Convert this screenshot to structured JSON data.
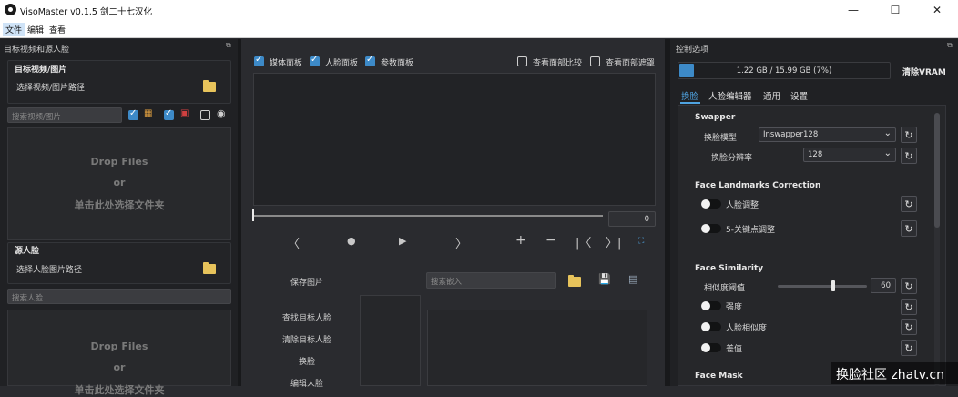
{
  "window": {
    "title": "VisoMaster v0.1.5 剑二十七汉化",
    "minimize": "—",
    "maximize": "☐",
    "close": "✕"
  },
  "menubar": [
    "文件",
    "编辑",
    "查看"
  ],
  "left_dock": {
    "title": "目标视频和源人脸",
    "target_group": {
      "label": "目标视频/图片",
      "path_label": "选择视频/图片路径"
    },
    "search_video": {
      "placeholder": "搜索视频/图片"
    },
    "drop1": {
      "line1": "Drop Files",
      "line2": "or",
      "line3": "单击此处选择文件夹"
    },
    "source_group": {
      "label": "源人脸",
      "path_label": "选择人脸图片路径"
    },
    "search_face": {
      "placeholder": "搜索人脸"
    },
    "drop2": {
      "line1": "Drop Files",
      "line2": "or",
      "line3": "单击此处选择文件夹"
    }
  },
  "center": {
    "checks": [
      {
        "label": "媒体面板",
        "checked": true
      },
      {
        "label": "人脸面板",
        "checked": true
      },
      {
        "label": "参数面板",
        "checked": true
      }
    ],
    "compare": {
      "label": "查看面部比较",
      "checked": false
    },
    "mask": {
      "label": "查看面部遮罩",
      "checked": false
    },
    "frame_value": "0",
    "save_image": "保存图片",
    "search_embed": {
      "placeholder": "搜索嵌入"
    },
    "buttons": [
      "查找目标人脸",
      "清除目标人脸",
      "换脸",
      "编辑人脸"
    ]
  },
  "right_dock": {
    "title": "控制选项",
    "vram": {
      "text": "1.22 GB / 15.99 GB (7%)",
      "fraction": 0.07,
      "clear_label": "清除VRAM"
    },
    "tabs": [
      "换脸",
      "人脸编辑器",
      "通用",
      "设置"
    ],
    "swapper": {
      "heading": "Swapper",
      "model_label": "换脸模型",
      "model_value": "Inswapper128",
      "res_label": "换脸分辨率",
      "res_value": "128"
    },
    "landmarks": {
      "heading": "Face Landmarks Correction",
      "adjust_label": "人脸调整",
      "keypoint_label": "5-关键点调整"
    },
    "similarity": {
      "heading": "Face Similarity",
      "threshold_label": "相似度阈值",
      "threshold_value": "60",
      "threshold_fraction": 0.6,
      "strength_label": "强度",
      "similarity_label": "人脸相似度",
      "diff_label": "差值"
    },
    "mask_heading": "Face Mask"
  },
  "watermark": "换脸社区 zhatv.cn",
  "colors": {
    "accent": "#3d8ac8",
    "tab_active": "#4fa3e0",
    "folder": "#e7c35b"
  }
}
